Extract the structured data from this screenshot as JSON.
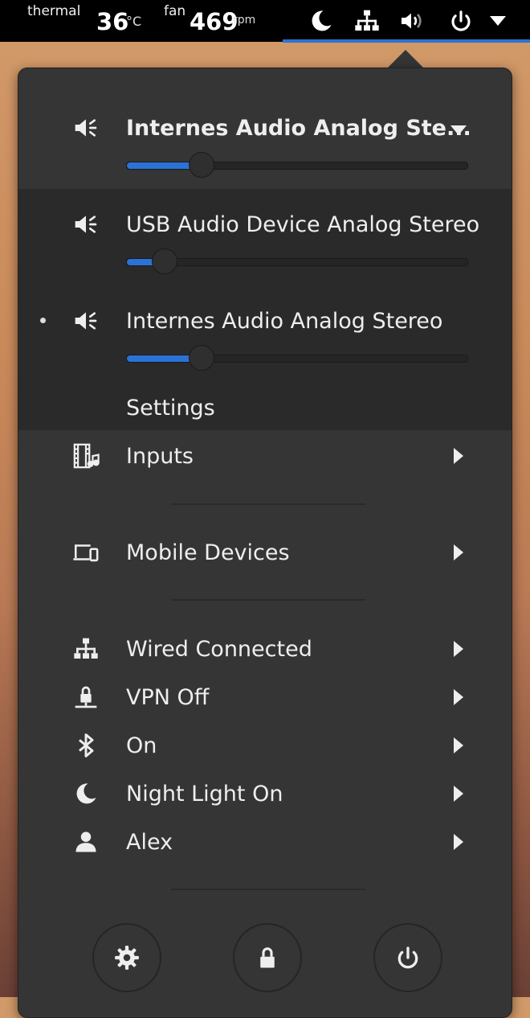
{
  "topbar": {
    "thermal_label": "thermal",
    "thermal_value": "36",
    "thermal_unit": "°C",
    "fan_label": "fan",
    "fan_value": "469",
    "fan_unit": "rpm",
    "icons": [
      "night-light-icon",
      "network-wired-icon",
      "volume-icon",
      "power-icon",
      "dropdown-arrow-icon"
    ]
  },
  "audio": {
    "current_device": "Internes Audio Analog Ste...",
    "current_volume": 0.22,
    "devices": [
      {
        "label": "USB Audio Device Analog Stereo",
        "volume": 0.11,
        "active": false
      },
      {
        "label": "Internes Audio Analog Stereo",
        "volume": 0.22,
        "active": true
      }
    ],
    "settings_label": "Settings"
  },
  "menu": {
    "inputs_label": "Inputs",
    "mobile_devices_label": "Mobile Devices",
    "wired_label": "Wired Connected",
    "vpn_label": "VPN Off",
    "bluetooth_label": "On",
    "night_light_label": "Night Light On",
    "user_label": "Alex"
  },
  "bottom_buttons": [
    "settings-icon",
    "lock-icon",
    "power-icon"
  ],
  "colors": {
    "accent": "#2b72d6",
    "menu_bg": "#353535",
    "submenu_bg": "#2a2a2a"
  }
}
